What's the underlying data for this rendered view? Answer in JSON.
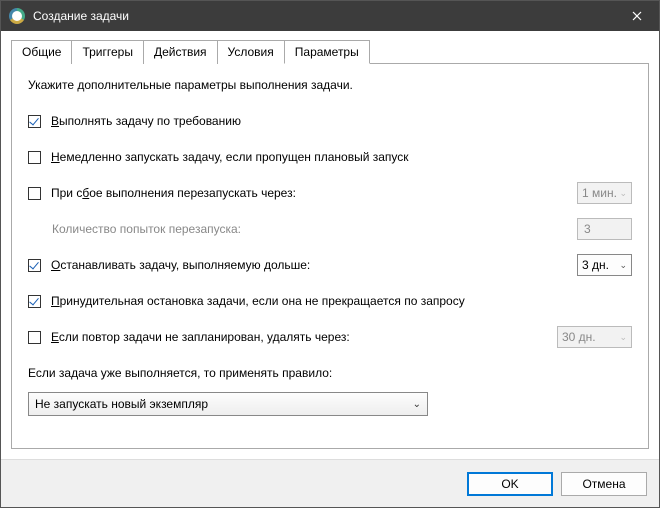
{
  "titlebar": {
    "title": "Создание задачи"
  },
  "tabs": {
    "general": "Общие",
    "triggers": "Триггеры",
    "actions": "Действия",
    "conditions": "Условия",
    "settings": "Параметры"
  },
  "panel": {
    "intro": "Укажите дополнительные параметры выполнения задачи.",
    "allow_demand_prefix": "В",
    "allow_demand_rest": "ыполнять задачу по требованию",
    "run_missed_prefix": "Н",
    "run_missed_rest": "емедленно запускать задачу, если пропущен плановый запуск",
    "restart_on_fail_prefix": "При с",
    "restart_on_fail_u": "б",
    "restart_on_fail_rest": "ое выполнения перезапускать через:",
    "restart_interval": "1 мин.",
    "restart_count_label": "Количество попыток перезапуска:",
    "restart_count_value": "3",
    "stop_longer_prefix": "О",
    "stop_longer_rest": "станавливать задачу, выполняемую дольше:",
    "stop_longer_value": "3 дн.",
    "force_stop_prefix": "П",
    "force_stop_rest": "ринудительная остановка задачи, если она не прекращается по запросу",
    "delete_after_prefix": "Е",
    "delete_after_rest": "сли повтор задачи не запланирован, удалять через:",
    "delete_after_value": "30 дн.",
    "rule_label": "Если задача уже выполняется, то применять правило:",
    "rule_value": "Не запускать новый экземпляр"
  },
  "buttons": {
    "ok": "OK",
    "cancel": "Отмена"
  }
}
